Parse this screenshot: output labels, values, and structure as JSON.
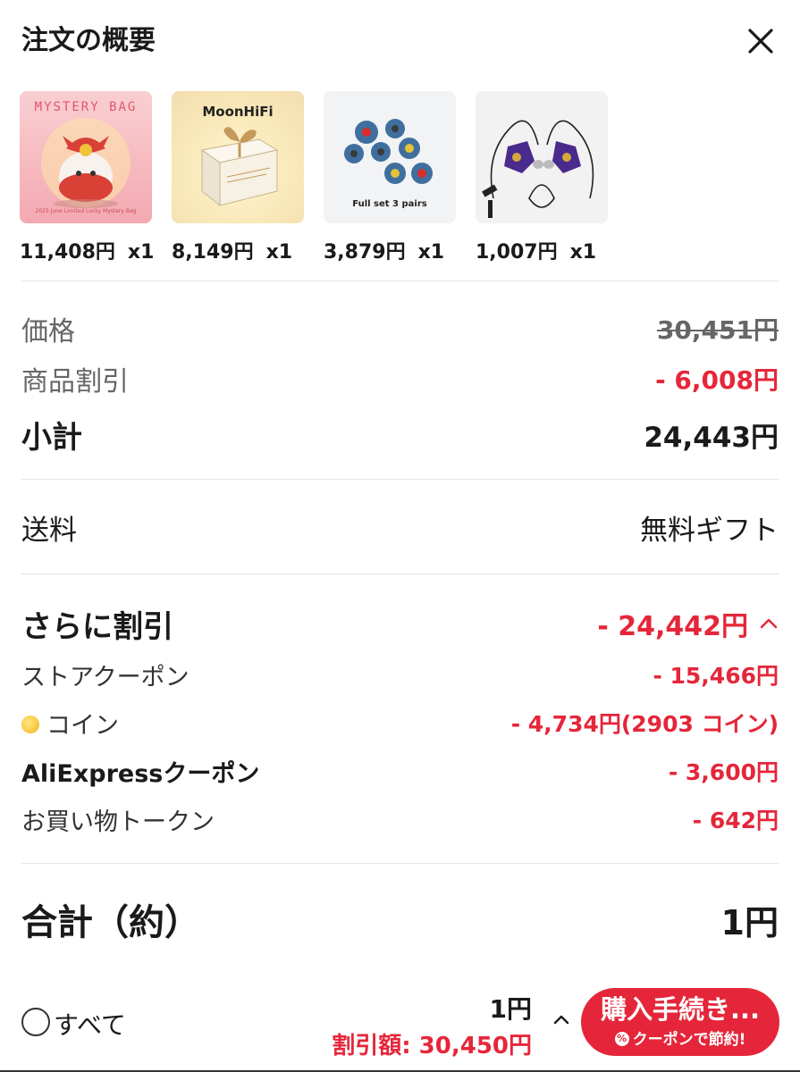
{
  "header": {
    "title": "注文の概要",
    "close_icon": "close-icon"
  },
  "items": [
    {
      "price": "11,408円",
      "qty": "x1",
      "image_label": "MYSTERY BAG",
      "image_caption": "2025 June Limited Lucky Mystery Bag"
    },
    {
      "price": "8,149円",
      "qty": "x1",
      "image_label": "MoonHiFi"
    },
    {
      "price": "3,879円",
      "qty": "x1",
      "image_label": "Full set 3 pairs"
    },
    {
      "price": "1,007円",
      "qty": "x1"
    }
  ],
  "price_summary": {
    "price_label": "価格",
    "price_value": "30,451円",
    "discount_label": "商品割引",
    "discount_value": "- 6,008円",
    "subtotal_label": "小計",
    "subtotal_value": "24,443円"
  },
  "shipping": {
    "label": "送料",
    "value": "無料ギフト"
  },
  "extra_discount": {
    "label": "さらに割引",
    "value": "- 24,442円",
    "lines": [
      {
        "label": "ストアクーポン",
        "value": "- 15,466円"
      },
      {
        "label": "コイン",
        "value": "- 4,734円(2903 コイン)",
        "icon": "coin-icon"
      },
      {
        "label": "AliExpressクーポン",
        "value": "- 3,600円"
      },
      {
        "label": "お買い物トークン",
        "value": "- 642円"
      }
    ]
  },
  "total": {
    "label": "合計（約）",
    "value": "1円"
  },
  "footer": {
    "select_all_label": "すべて",
    "total_value": "1円",
    "discount_text": "割引額: 30,450円",
    "checkout_label": "購入手続き...",
    "checkout_sub": "クーポンで節約!",
    "percent_glyph": "%"
  },
  "colors": {
    "accent_red": "#e5263a",
    "text": "#1a1a1a",
    "muted": "#666666",
    "divider": "#e6e6e6"
  }
}
